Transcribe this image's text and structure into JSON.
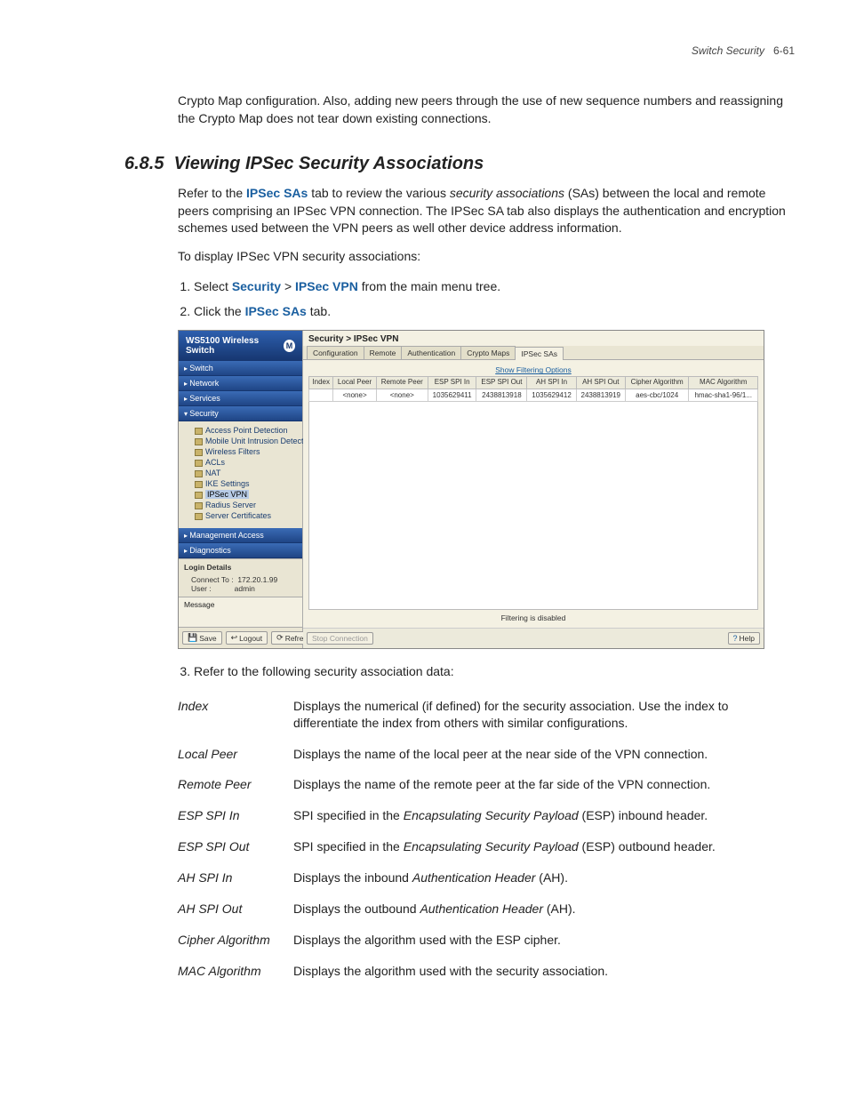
{
  "header": {
    "title_italic": "Switch Security",
    "page_no": "6-61"
  },
  "intro": "Crypto Map configuration. Also, adding new peers through the use of new sequence numbers and reassigning the Crypto Map does not tear down existing connections.",
  "section": {
    "number": "6.8.5",
    "title": "Viewing IPSec Security Associations"
  },
  "para1_a": "Refer to the ",
  "para1_b": "IPSec SAs",
  "para1_c": " tab to review the various ",
  "para1_d": "security associations",
  "para1_e": " (SAs) between the local and remote peers comprising an IPSec VPN connection. The IPSec SA tab also displays the authentication and encryption schemes used between the VPN peers as well other device address information.",
  "para2": "To display IPSec VPN security associations:",
  "step1_a": "Select ",
  "step1_b": "Security",
  "step1_c": " > ",
  "step1_d": "IPSec VPN",
  "step1_e": " from the main menu tree.",
  "step2_a": "Click the ",
  "step2_b": "IPSec SAs",
  "step2_c": " tab.",
  "step3": "Refer to the following security association data:",
  "app": {
    "title_a": "WS5100",
    "title_b": " Wireless Switch",
    "nav": [
      "Switch",
      "Network",
      "Services",
      "Security",
      "Management Access",
      "Diagnostics"
    ],
    "tree": [
      "Access Point Detection",
      "Mobile Unit Intrusion Detection",
      "Wireless Filters",
      "ACLs",
      "NAT",
      "IKE Settings",
      "IPSec VPN",
      "Radius Server",
      "Server Certificates"
    ],
    "login": {
      "head": "Login Details",
      "connect_lbl": "Connect To :",
      "connect_val": "172.20.1.99",
      "user_lbl": "User :",
      "user_val": "admin"
    },
    "msg_head": "Message",
    "btn_save": "Save",
    "btn_logout": "Logout",
    "btn_refresh": "Refresh",
    "breadcrumb": "Security > IPSec VPN",
    "tabs": [
      "Configuration",
      "Remote",
      "Authentication",
      "Crypto Maps",
      "IPSec SAs"
    ],
    "filter_link": "Show Filtering Options",
    "cols": [
      "Index",
      "Local Peer",
      "Remote Peer",
      "ESP SPI In",
      "ESP SPI Out",
      "AH SPI In",
      "AH SPI Out",
      "Cipher Algorithm",
      "MAC Algorithm"
    ],
    "row": [
      "",
      "<none>",
      "<none>",
      "1035629411",
      "2438813918",
      "1035629412",
      "2438813919",
      "aes-cbc/1024",
      "hmac-sha1-96/1..."
    ],
    "status": "Filtering is disabled",
    "btn_stop": "Stop Connection",
    "btn_help": "Help"
  },
  "defs": [
    {
      "term": "Index",
      "desc": "Displays the numerical (if defined) for the security association. Use the index to differentiate the index from others with similar configurations."
    },
    {
      "term": "Local Peer",
      "desc": "Displays the name of the local peer at the near side of the VPN connection."
    },
    {
      "term": "Remote Peer",
      "desc": "Displays the name of the remote peer at the far side of the VPN connection."
    },
    {
      "term": "ESP SPI In",
      "desc_a": "SPI specified in the ",
      "desc_i": "Encapsulating Security Payload",
      "desc_b": " (ESP) inbound header."
    },
    {
      "term": "ESP SPI Out",
      "desc_a": "SPI specified in the ",
      "desc_i": "Encapsulating Security Payload",
      "desc_b": " (ESP) outbound header."
    },
    {
      "term": "AH SPI In",
      "desc_a": "Displays the inbound ",
      "desc_i": "Authentication Header",
      "desc_b": " (AH)."
    },
    {
      "term": "AH SPI Out",
      "desc_a": "Displays the outbound ",
      "desc_i": "Authentication Header",
      "desc_b": " (AH)."
    },
    {
      "term": "Cipher Algorithm",
      "desc": "Displays the algorithm used with the ESP cipher."
    },
    {
      "term": "MAC Algorithm",
      "desc": "Displays the algorithm used with the security association."
    }
  ]
}
